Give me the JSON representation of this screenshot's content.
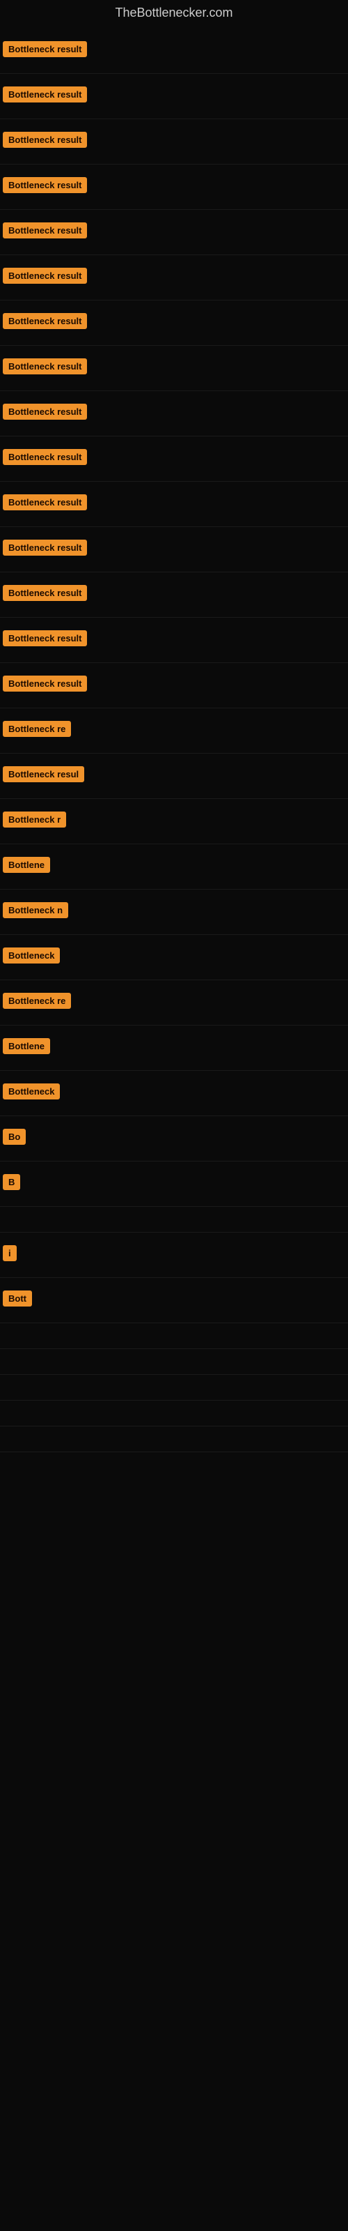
{
  "site": {
    "title": "TheBottlenecker.com"
  },
  "rows": [
    {
      "label": "Bottleneck result",
      "truncated": false
    },
    {
      "label": "Bottleneck result",
      "truncated": false
    },
    {
      "label": "Bottleneck result",
      "truncated": false
    },
    {
      "label": "Bottleneck result",
      "truncated": false
    },
    {
      "label": "Bottleneck result",
      "truncated": false
    },
    {
      "label": "Bottleneck result",
      "truncated": false
    },
    {
      "label": "Bottleneck result",
      "truncated": false
    },
    {
      "label": "Bottleneck result",
      "truncated": false
    },
    {
      "label": "Bottleneck result",
      "truncated": false
    },
    {
      "label": "Bottleneck result",
      "truncated": false
    },
    {
      "label": "Bottleneck result",
      "truncated": false
    },
    {
      "label": "Bottleneck result",
      "truncated": false
    },
    {
      "label": "Bottleneck result",
      "truncated": false
    },
    {
      "label": "Bottleneck result",
      "truncated": false
    },
    {
      "label": "Bottleneck result",
      "truncated": false
    },
    {
      "label": "Bottleneck re",
      "truncated": true
    },
    {
      "label": "Bottleneck resul",
      "truncated": true
    },
    {
      "label": "Bottleneck r",
      "truncated": true
    },
    {
      "label": "Bottlene",
      "truncated": true
    },
    {
      "label": "Bottleneck n",
      "truncated": true
    },
    {
      "label": "Bottleneck",
      "truncated": true
    },
    {
      "label": "Bottleneck re",
      "truncated": true
    },
    {
      "label": "Bottlene",
      "truncated": true
    },
    {
      "label": "Bottleneck",
      "truncated": true
    },
    {
      "label": "Bo",
      "truncated": true
    },
    {
      "label": "B",
      "truncated": true
    },
    {
      "label": "",
      "truncated": true
    },
    {
      "label": "i",
      "truncated": true
    },
    {
      "label": "Bott",
      "truncated": true
    },
    {
      "label": "",
      "truncated": true
    },
    {
      "label": "",
      "truncated": true
    },
    {
      "label": "",
      "truncated": true
    },
    {
      "label": "",
      "truncated": true
    },
    {
      "label": "",
      "truncated": true
    }
  ]
}
